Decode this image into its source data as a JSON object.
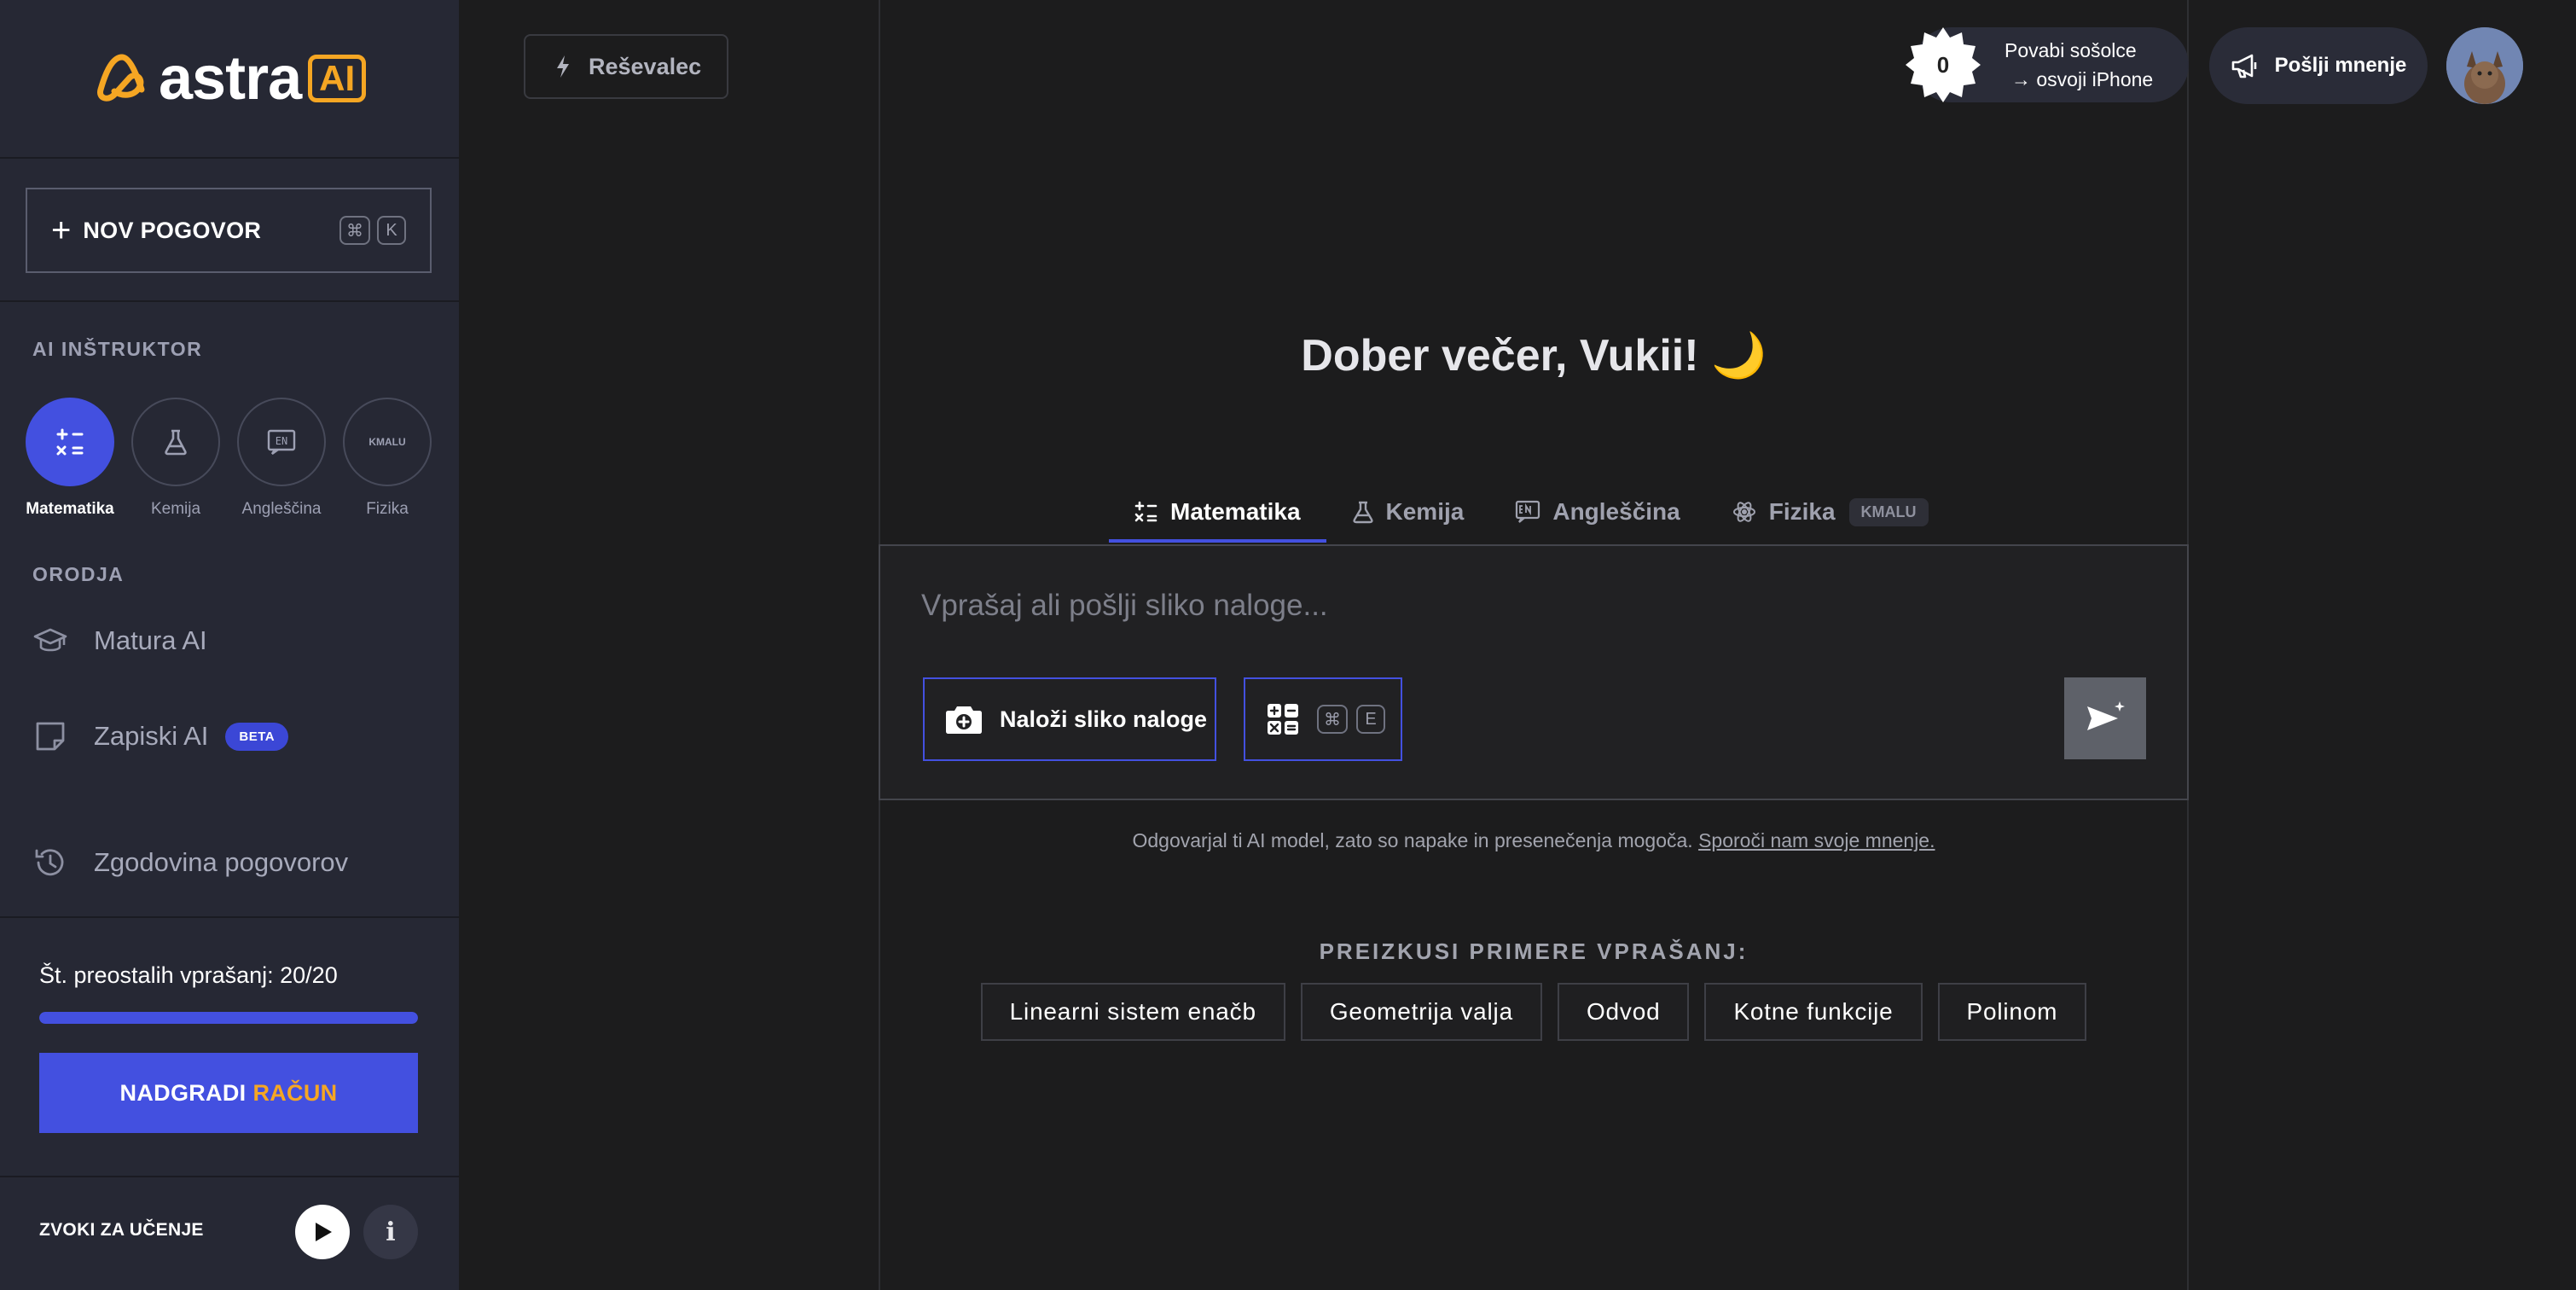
{
  "brand": {
    "name": "astra",
    "ai_badge": "AI"
  },
  "sidebar": {
    "new_chat": {
      "label": "NOV POGOVOR",
      "keys": [
        "⌘",
        "K"
      ]
    },
    "instructor_title": "AI INŠTRUKTOR",
    "instructors": [
      {
        "label": "Matematika",
        "active": true
      },
      {
        "label": "Kemija",
        "active": false
      },
      {
        "label": "Angleščina",
        "active": false,
        "icon_text": "EN"
      },
      {
        "label": "Fizika",
        "active": false,
        "icon_text": "KMALU"
      }
    ],
    "tools_title": "ORODJA",
    "tools": [
      {
        "label": "Matura AI"
      },
      {
        "label": "Zapiski AI",
        "badge": "BETA"
      },
      {
        "label": "Zgodovina pogovorov"
      }
    ],
    "remaining": "Št. preostalih vprašanj: 20/20",
    "remaining_fraction": 1.0,
    "upgrade": {
      "label": "NADGRADI",
      "accent": "RAČUN"
    },
    "sounds_label": "ZVOKI ZA UČENJE",
    "info_glyph": "i"
  },
  "header": {
    "solver_label": "Reševalec",
    "invite": {
      "count": "0",
      "line1": "Povabi sošolce",
      "line2": "→ osvoji iPhone"
    },
    "feedback_label": "Pošlji mnenje"
  },
  "main": {
    "greeting": "Dober večer, Vukii! 🌙",
    "tabs": [
      {
        "label": "Matematika",
        "active": true
      },
      {
        "label": "Kemija",
        "active": false
      },
      {
        "label": "Angleščina",
        "active": false
      },
      {
        "label": "Fizika",
        "active": false,
        "pill": "KMALU"
      }
    ],
    "composer": {
      "placeholder": "Vprašaj ali pošlji sliko naloge...",
      "upload_label": "Naloži sliko naloge",
      "calc_keys": [
        "⌘",
        "E"
      ]
    },
    "disclaimer": "Odgovarjal ti AI model, zato so napake in presenečenja mogoča.",
    "disclaimer_link": "Sporoči nam svoje mnenje.",
    "examples_title": "PREIZKUSI PRIMERE VPRAŠANJ:",
    "examples": [
      "Linearni sistem enačb",
      "Geometrija valja",
      "Odvod",
      "Kotne funkcije",
      "Polinom"
    ]
  },
  "colors": {
    "accent": "#4350e0",
    "brand_orange": "#f5a623",
    "sidebar_bg": "#262834",
    "main_bg": "#1c1c1d"
  }
}
